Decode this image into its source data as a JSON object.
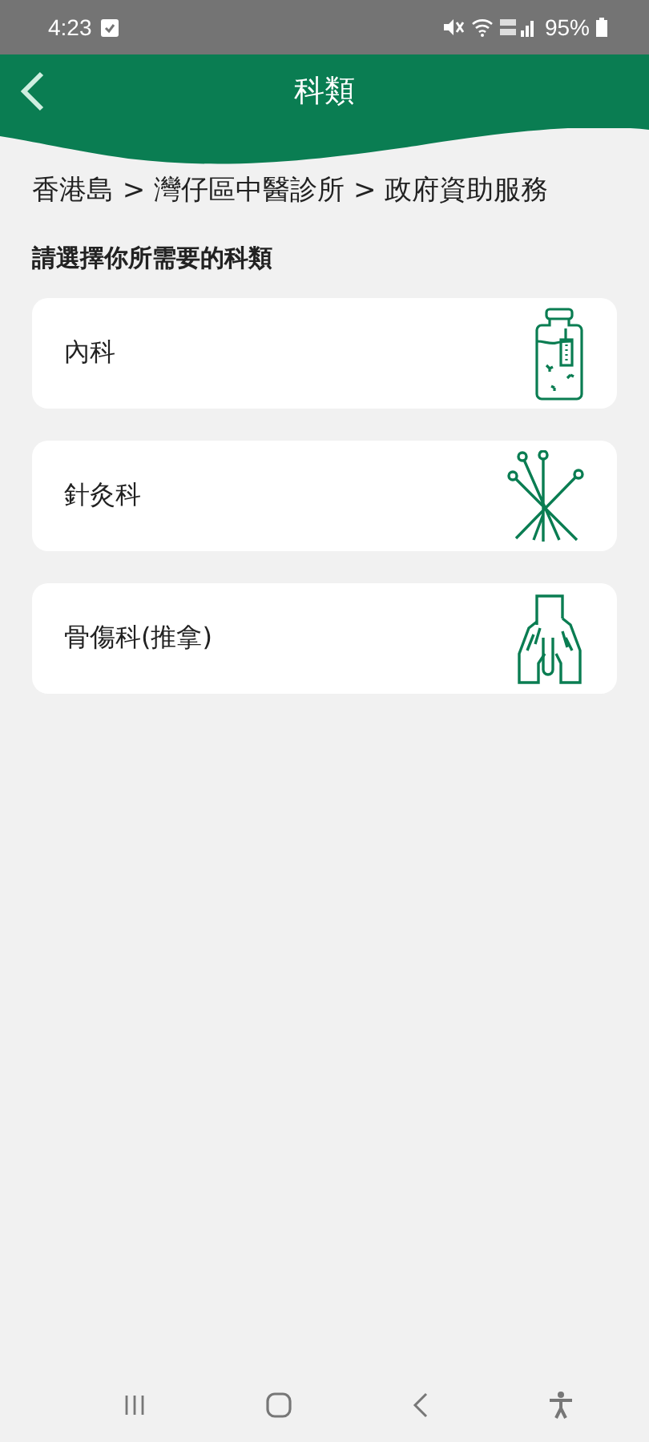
{
  "status_bar": {
    "time": "4:23",
    "battery": "95%"
  },
  "header": {
    "title": "科類"
  },
  "breadcrumb": "香港島 > 灣仔區中醫診所 > 政府資助服務",
  "prompt": "請選擇你所需要的科類",
  "departments": [
    {
      "label": "內科",
      "kind": "vial"
    },
    {
      "label": "針灸科",
      "kind": "needles"
    },
    {
      "label": "骨傷科(推拿)",
      "kind": "hands"
    }
  ]
}
